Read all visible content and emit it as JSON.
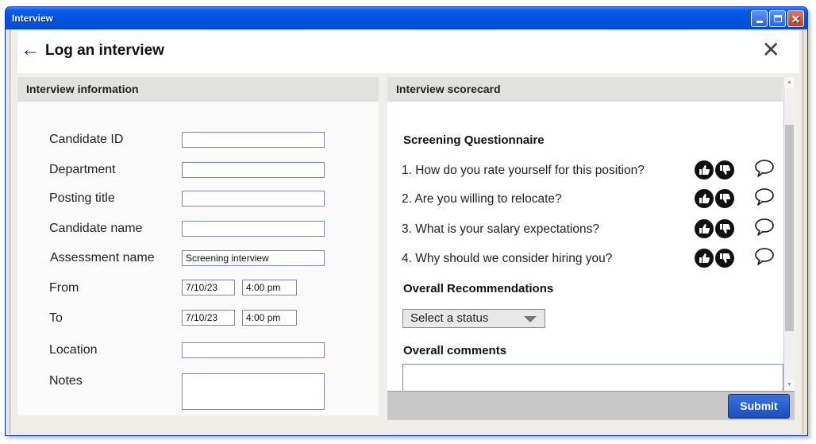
{
  "window": {
    "title": "Interview",
    "minimize": "",
    "maximize": "",
    "close": "✕"
  },
  "header": {
    "back_icon": "←",
    "title": "Log an interview",
    "close_icon": "✕"
  },
  "interview_info": {
    "heading": "Interview information",
    "fields": {
      "candidate_id": {
        "label": "Candidate ID",
        "value": ""
      },
      "department": {
        "label": "Department",
        "value": ""
      },
      "posting_title": {
        "label": "Posting title",
        "value": ""
      },
      "candidate_name": {
        "label": "Candidate name",
        "value": ""
      },
      "assessment_name": {
        "label": "Assessment name",
        "value": "Screening interview"
      },
      "from": {
        "label": "From",
        "date": "7/10/23",
        "time": "4:00 pm"
      },
      "to": {
        "label": "To",
        "date": "7/10/23",
        "time": "4:00 pm"
      },
      "location": {
        "label": "Location",
        "value": ""
      },
      "notes": {
        "label": "Notes",
        "value": ""
      }
    }
  },
  "scorecard": {
    "heading": "Interview scorecard",
    "questionnaire_title": "Screening Questionnaire",
    "questions": [
      "1. How do you rate yourself for this position?",
      "2. Are you willing to relocate?",
      "3. What is your salary expectations?",
      "4. Why should we consider hiring you?"
    ],
    "recommendations_title": "Overall Recommendations",
    "status_select": "Select a status",
    "comments_title": "Overall comments",
    "submit_label": "Submit"
  },
  "colors": {
    "titlebar": "#0054e3",
    "submit": "#2a5fcc",
    "panel_header": "#e1e1e1"
  }
}
